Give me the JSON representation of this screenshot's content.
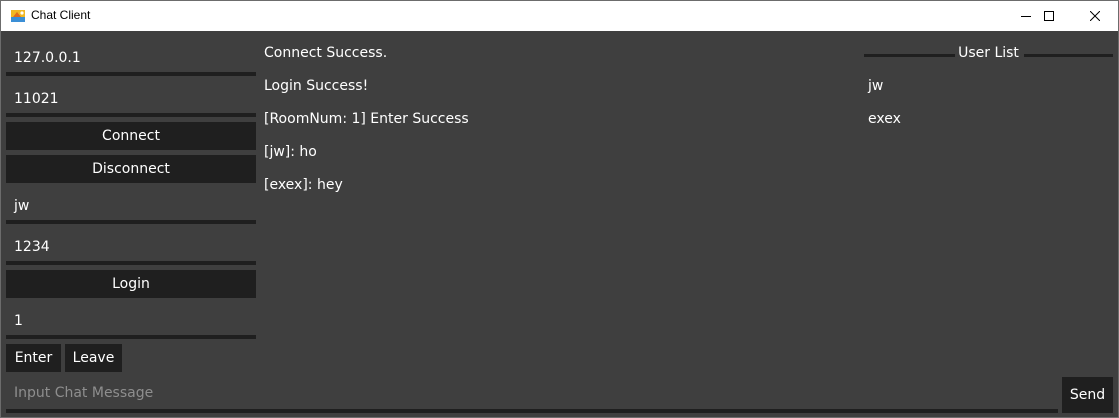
{
  "window": {
    "title": "Chat Client",
    "icon": "app-icon",
    "controls": [
      "minimize-icon",
      "maximize-icon",
      "close-icon"
    ]
  },
  "sidebar": {
    "ip_value": "127.0.0.1",
    "port_value": "11021",
    "connect_label": "Connect",
    "disconnect_label": "Disconnect",
    "user_id_value": "jw",
    "password_value": "1234",
    "login_label": "Login",
    "room_number_value": "1",
    "enter_label": "Enter",
    "leave_label": "Leave"
  },
  "chat": {
    "messages": [
      "Connect Success.",
      "Login Success!",
      "[RoomNum: 1] Enter Success",
      "[jw]: ho",
      "[exex]: hey"
    ]
  },
  "user_list": {
    "title": "User List",
    "users": [
      "jw",
      "exex"
    ]
  },
  "message_bar": {
    "placeholder": "Input Chat Message",
    "send_label": "Send"
  },
  "colors": {
    "background": "#3f3f3f",
    "panel_dark": "#1f1f1f",
    "text": "#ffffff",
    "placeholder": "#8e8e8e"
  }
}
